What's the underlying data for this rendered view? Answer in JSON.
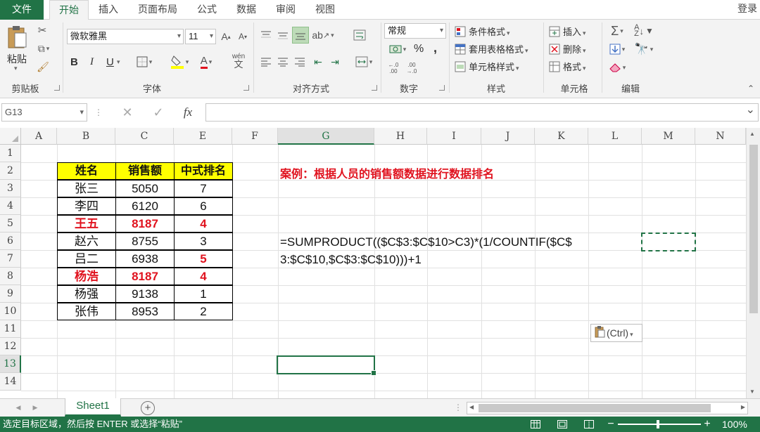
{
  "tabs": {
    "file": "文件",
    "home": "开始",
    "insert": "插入",
    "layout": "页面布局",
    "formulas": "公式",
    "data": "数据",
    "review": "审阅",
    "view": "视图",
    "login": "登录"
  },
  "ribbon": {
    "clipboard": {
      "paste": "粘贴",
      "label": "剪贴板"
    },
    "font": {
      "name": "微软雅黑",
      "size": "11",
      "label": "字体",
      "bold": "B",
      "italic": "I",
      "underline": "U",
      "phonetic": "wén"
    },
    "alignment": {
      "label": "对齐方式"
    },
    "number": {
      "format": "常规",
      "label": "数字",
      "percent": "%",
      "comma": ","
    },
    "styles": {
      "conditional": "条件格式",
      "table": "套用表格格式",
      "cell": "单元格样式",
      "label": "样式"
    },
    "cells": {
      "insert": "插入",
      "delete": "删除",
      "format": "格式",
      "label": "单元格"
    },
    "editing": {
      "label": "编辑"
    }
  },
  "formula_bar": {
    "name_box": "G13",
    "fx": "fx",
    "content": ""
  },
  "grid": {
    "columns": [
      "A",
      "B",
      "C",
      "E",
      "F",
      "G",
      "H",
      "I",
      "J",
      "K",
      "L",
      "M",
      "N"
    ],
    "rows": [
      "1",
      "2",
      "3",
      "4",
      "5",
      "6",
      "7",
      "8",
      "9",
      "10",
      "11",
      "12",
      "13",
      "14"
    ],
    "selected_column": "G",
    "selected_row": "13"
  },
  "table": {
    "headers": [
      "姓名",
      "销售额",
      "中式排名"
    ],
    "rows": [
      {
        "name": "张三",
        "sales": "5050",
        "rank": "7",
        "highlight_row": false,
        "highlight_rank": false
      },
      {
        "name": "李四",
        "sales": "6120",
        "rank": "6",
        "highlight_row": false,
        "highlight_rank": false
      },
      {
        "name": "王五",
        "sales": "8187",
        "rank": "4",
        "highlight_row": true,
        "highlight_rank": true
      },
      {
        "name": "赵六",
        "sales": "8755",
        "rank": "3",
        "highlight_row": false,
        "highlight_rank": false
      },
      {
        "name": "吕二",
        "sales": "6938",
        "rank": "5",
        "highlight_row": false,
        "highlight_rank": true
      },
      {
        "name": "杨浩",
        "sales": "8187",
        "rank": "4",
        "highlight_row": true,
        "highlight_rank": true
      },
      {
        "name": "杨强",
        "sales": "9138",
        "rank": "1",
        "highlight_row": false,
        "highlight_rank": false
      },
      {
        "name": "张伟",
        "sales": "8953",
        "rank": "2",
        "highlight_row": false,
        "highlight_rank": false
      }
    ]
  },
  "case_title": "案例：根据人员的销售额数据进行数据排名",
  "formula_line1": "=SUMPRODUCT(($C$3:$C$10>C3)*(1/COUNTIF($C$",
  "formula_line2": "3:$C$10,$C$3:$C$10)))+1",
  "paste_options": "(Ctrl)",
  "sheet": {
    "name": "Sheet1"
  },
  "status": {
    "message": "选定目标区域，然后按 ENTER 或选择“粘贴”",
    "zoom": "100%"
  },
  "colors": {
    "accent": "#217346",
    "header_fill": "#ffff00",
    "highlight_text": "#e0131f"
  }
}
